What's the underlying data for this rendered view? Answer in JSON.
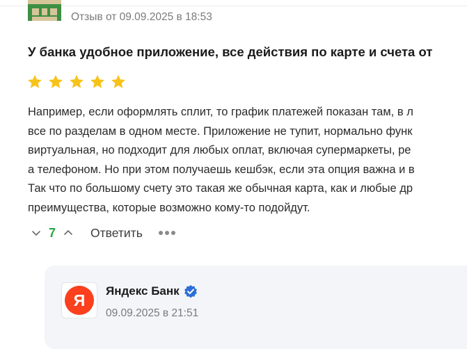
{
  "review": {
    "meta": "Отзыв от 09.09.2025 в 18:53",
    "title": "У банка удобное приложение, все действия по карте и счета от",
    "rating": 5,
    "rating_max": 5,
    "star_color": "#f7c31a",
    "text_lines": [
      "Например, если оформлять сплит, то график платежей показан там, в л",
      "все по разделам в одном месте. Приложение не тупит, нормально функ",
      "виртуальная, но подходит для любых оплат, включая супермаркеты, ре",
      "а телефоном. Но при этом получаешь кешбэк, если эта опция важна и в",
      "Так что по большому счету это такая же обычная карта, как и любые др",
      "преимущества, которые возможно кому-то подойдут."
    ],
    "vote_count": "7",
    "reply_label": "Ответить",
    "icons": {
      "downvote": "chevron-down-icon",
      "upvote": "chevron-up-icon",
      "more": "more-dots-icon"
    }
  },
  "bank_reply": {
    "name": "Яндекс Банк",
    "date": "09.09.2025 в 21:51",
    "logo_letter": "Я",
    "logo_color": "#fc3f1d",
    "verified_color": "#2d6fd6"
  }
}
